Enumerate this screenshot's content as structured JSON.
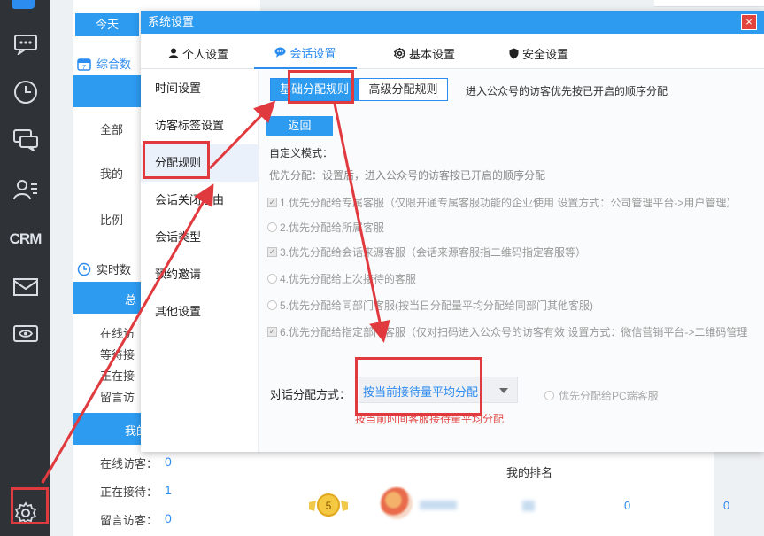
{
  "rail": {
    "items": [
      "logo-icon",
      "chat-icon",
      "clock-icon",
      "conversation-icon",
      "contacts-icon",
      "crm",
      "mail-icon",
      "eye-icon",
      "settings-icon"
    ],
    "crm_label": "CRM"
  },
  "background": {
    "today_tab": "今天",
    "overview_title": "综合数",
    "realtime_title": "实时数",
    "rows_top": [
      "全部",
      "我的",
      "比例"
    ],
    "bar1_label": "总",
    "rows_mid": [
      "在线访",
      "等待接",
      "正在接",
      "留言访"
    ],
    "bar2_label": "我的",
    "my_stats": [
      {
        "label": "在线访客：",
        "value": "0"
      },
      {
        "label": "正在接待：",
        "value": "1"
      },
      {
        "label": "留言访客：",
        "value": "0"
      }
    ],
    "ranking_title": "我的排名",
    "ranking_row": {
      "rank": "5",
      "val1": "0",
      "val2": "0"
    }
  },
  "dialog": {
    "title": "系统设置",
    "close": "×",
    "tabs": [
      {
        "label": "个人设置",
        "icon": "user-icon"
      },
      {
        "label": "会话设置",
        "icon": "chat-bubble-icon"
      },
      {
        "label": "基本设置",
        "icon": "gear-icon"
      },
      {
        "label": "安全设置",
        "icon": "shield-icon"
      }
    ],
    "sidebar": [
      "时间设置",
      "访客标签设置",
      "分配规则",
      "会话关闭理由",
      "会话类型",
      "预约邀请",
      "其他设置"
    ],
    "subtabs": [
      "基础分配规则",
      "高级分配规则"
    ],
    "subtab_note": "进入公众号的访客优先按已开启的顺序分配",
    "back_button": "返回",
    "custom_mode": "自定义模式：",
    "priority_note": "优先分配：设置后，进入公众号的访客按已开启的顺序分配",
    "options": [
      {
        "type": "checkbox",
        "text": "1.优先分配给专属客服（仅限开通专属客服功能的企业使用   设置方式：公司管理平台->用户管理）"
      },
      {
        "type": "radio",
        "text": "2.优先分配给所属客服"
      },
      {
        "type": "checkbox",
        "text": "3.优先分配给会话来源客服（会话来源客服指二维码指定客服等）"
      },
      {
        "type": "radio",
        "text": "4.优先分配给上次接待的客服"
      },
      {
        "type": "radio",
        "text": "5.优先分配给同部门客服(按当日分配量平均分配给同部门其他客服)"
      },
      {
        "type": "checkbox",
        "text": "6.优先分配给指定部门客服（仅对扫码进入公众号的访客有效   设置方式：微信营销平台->二维码管理"
      }
    ],
    "mode_label": "对话分配方式：",
    "mode_value": "按当前接待量平均分配",
    "pc_option": "优先分配给PC端客服",
    "mode_hint": "按当前时间客服接待量平均分配"
  },
  "colors": {
    "accent": "#2d9bf0",
    "annotation": "#e0393e",
    "rail": "#2f3338"
  }
}
